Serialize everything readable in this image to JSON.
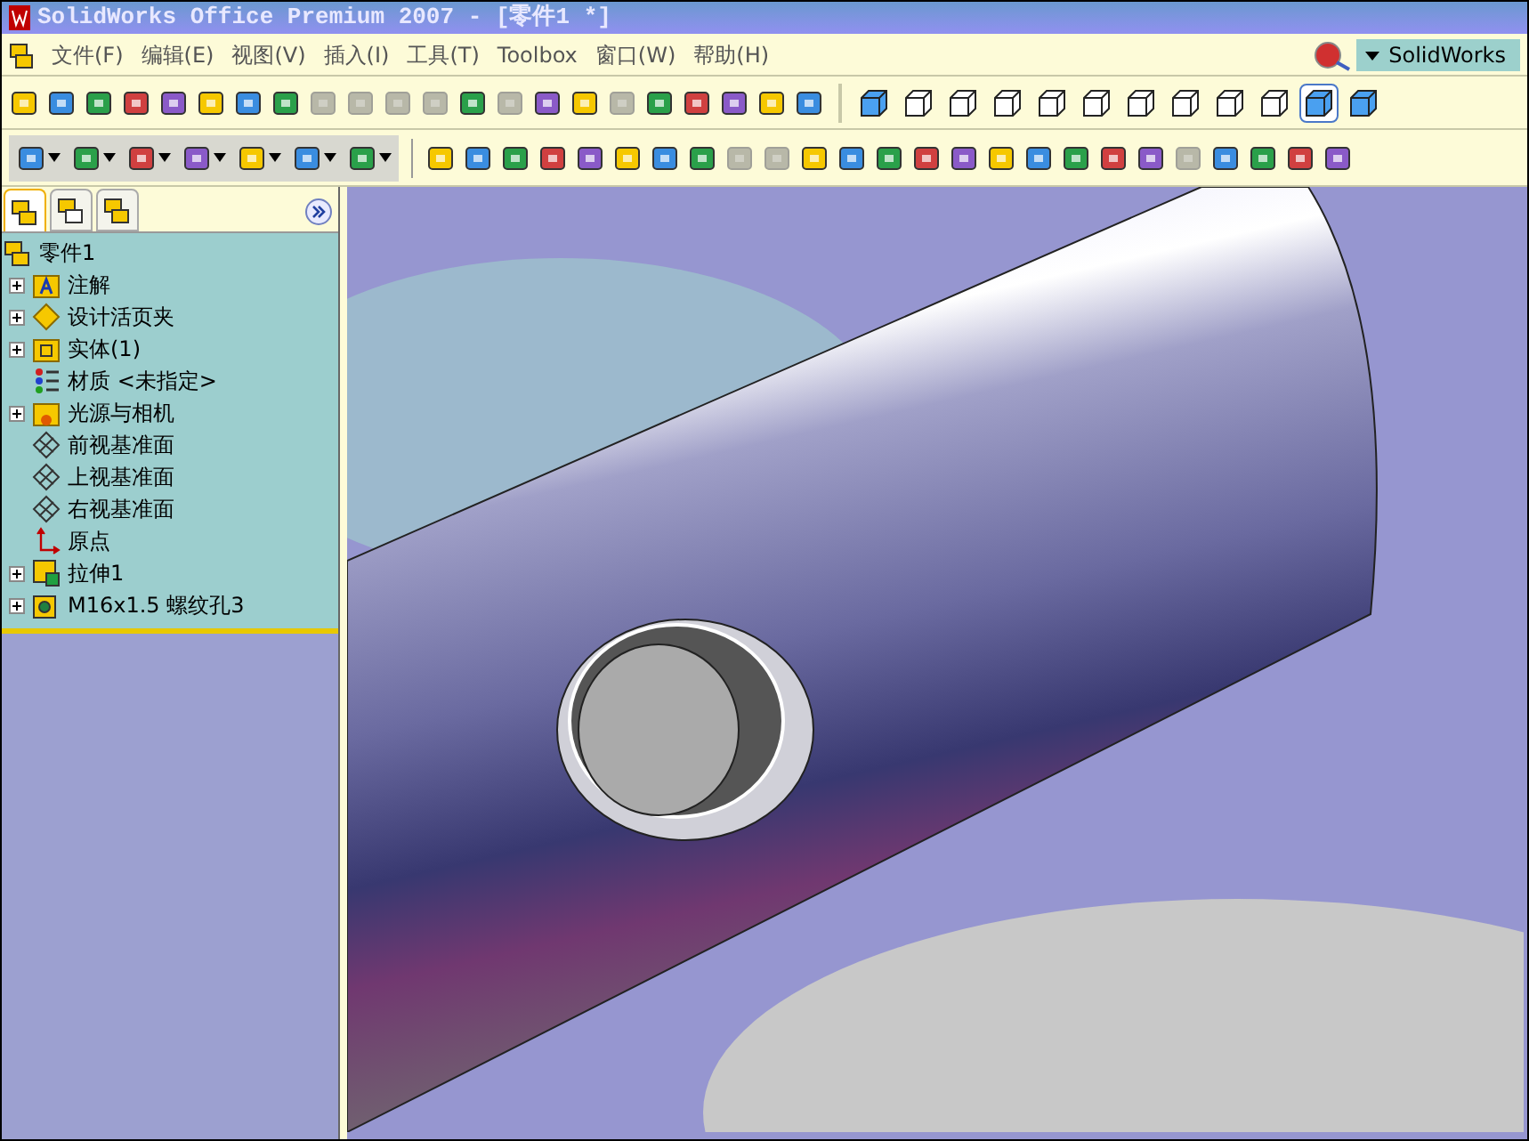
{
  "window": {
    "title": "SolidWorks Office Premium 2007 - [零件1 *]"
  },
  "menu": [
    "文件(F)",
    "编辑(E)",
    "视图(V)",
    "插入(I)",
    "工具(T)",
    "Toolbox",
    "窗口(W)",
    "帮助(H)"
  ],
  "search": {
    "value": "SolidWorks"
  },
  "toolbar_standard": [
    {
      "disabled": false
    },
    {
      "disabled": false
    },
    {
      "disabled": false
    },
    {
      "disabled": false
    },
    {
      "disabled": false
    },
    {
      "disabled": false
    },
    {
      "disabled": false
    },
    {
      "disabled": false
    },
    {
      "disabled": true
    },
    {
      "disabled": true
    },
    {
      "disabled": true
    },
    {
      "disabled": true
    },
    {
      "disabled": false
    },
    {
      "disabled": true
    },
    {
      "disabled": false
    },
    {
      "disabled": false
    },
    {
      "disabled": true
    },
    {
      "disabled": false
    },
    {
      "disabled": false
    },
    {
      "disabled": false
    },
    {
      "disabled": false
    },
    {
      "disabled": false
    }
  ],
  "toolbar_views": [
    {
      "selected": false
    },
    {
      "selected": false
    },
    {
      "selected": false
    },
    {
      "selected": false
    },
    {
      "selected": false
    },
    {
      "selected": false
    },
    {
      "selected": false
    },
    {
      "selected": false
    },
    {
      "selected": false
    },
    {
      "selected": false
    },
    {
      "selected": true
    },
    {
      "selected": false
    }
  ],
  "toolbar_features": [
    {
      "disabled": false
    },
    {
      "disabled": false
    },
    {
      "disabled": false
    },
    {
      "disabled": false
    },
    {
      "disabled": false
    },
    {
      "disabled": false
    },
    {
      "disabled": false
    },
    {
      "disabled": false
    },
    {
      "disabled": true
    },
    {
      "disabled": true
    },
    {
      "disabled": false
    },
    {
      "disabled": false
    },
    {
      "disabled": false
    },
    {
      "disabled": false
    },
    {
      "disabled": false
    },
    {
      "disabled": false
    },
    {
      "disabled": false
    },
    {
      "disabled": false
    },
    {
      "disabled": false
    },
    {
      "disabled": false
    },
    {
      "disabled": true
    },
    {
      "disabled": false
    },
    {
      "disabled": false
    },
    {
      "disabled": false
    },
    {
      "disabled": false
    }
  ],
  "panel_tabs": [
    {
      "selected": true
    },
    {
      "selected": false
    },
    {
      "selected": false
    }
  ],
  "tree": {
    "root": "零件1",
    "items": [
      {
        "label": "注解",
        "expandable": true,
        "kind": "annotation"
      },
      {
        "label": "设计活页夹",
        "expandable": true,
        "kind": "binder"
      },
      {
        "label": "实体(1)",
        "expandable": true,
        "kind": "folder"
      },
      {
        "label": "材质 <未指定>",
        "expandable": false,
        "kind": "material"
      },
      {
        "label": "光源与相机",
        "expandable": true,
        "kind": "lights"
      },
      {
        "label": "前视基准面",
        "expandable": false,
        "kind": "plane"
      },
      {
        "label": "上视基准面",
        "expandable": false,
        "kind": "plane"
      },
      {
        "label": "右视基准面",
        "expandable": false,
        "kind": "plane"
      },
      {
        "label": "原点",
        "expandable": false,
        "kind": "origin"
      },
      {
        "label": "拉伸1",
        "expandable": true,
        "kind": "feature"
      },
      {
        "label": "M16x1.5 螺纹孔3",
        "expandable": true,
        "kind": "hole"
      }
    ]
  }
}
